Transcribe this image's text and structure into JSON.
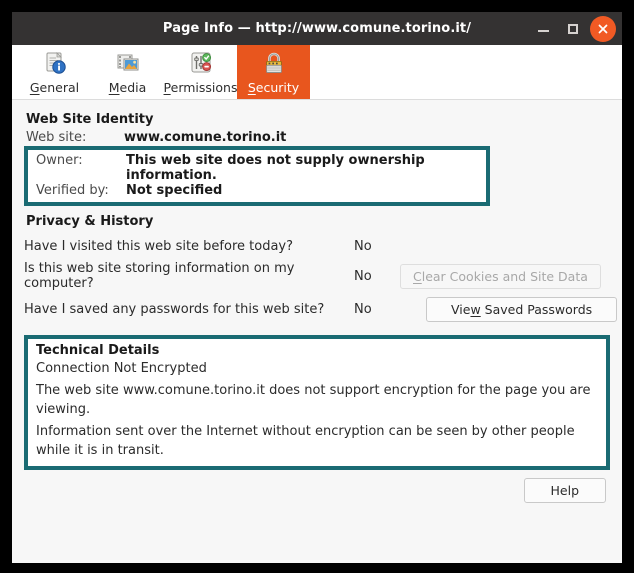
{
  "window": {
    "title": "Page Info — http://www.comune.torino.it/",
    "controls": {
      "minimize": "minimize-button",
      "maximize": "maximize-button",
      "close": "close-button"
    }
  },
  "tabs": [
    {
      "id": "general",
      "label": "General",
      "accesskey": "G",
      "icon": "document-info-icon",
      "selected": false
    },
    {
      "id": "media",
      "label": "Media",
      "accesskey": "M",
      "icon": "media-image-icon",
      "selected": false
    },
    {
      "id": "permissions",
      "label": "Permissions",
      "accesskey": "P",
      "icon": "sliders-check-icon",
      "selected": false
    },
    {
      "id": "security",
      "label": "Security",
      "accesskey": "S",
      "icon": "padlock-icon",
      "selected": true
    }
  ],
  "identity": {
    "heading": "Web Site Identity",
    "website_label": "Web site:",
    "website_value": "www.comune.torino.it",
    "owner_label": "Owner:",
    "owner_value": "This web site does not supply ownership information.",
    "verified_label": "Verified by:",
    "verified_value": "Not specified"
  },
  "privacy": {
    "heading": "Privacy & History",
    "rows": [
      {
        "question": "Have I visited this web site before today?",
        "answer": "No",
        "button": null
      },
      {
        "question": "Is this web site storing information on my computer?",
        "answer": "No",
        "button": {
          "label": "Clear Cookies and Site Data",
          "accesskey": "C",
          "disabled": true
        }
      },
      {
        "question": "Have I saved any passwords for this web site?",
        "answer": "No",
        "button": {
          "label": "View Saved Passwords",
          "accesskey": "w",
          "disabled": false
        }
      }
    ]
  },
  "technical": {
    "heading": "Technical Details",
    "status": "Connection Not Encrypted",
    "line1": "The web site www.comune.torino.it does not support encryption for the page you are viewing.",
    "line2": "Information sent over the Internet without encryption can be seen by other people while it is in transit."
  },
  "footer": {
    "help_label": "Help"
  },
  "colors": {
    "titlebar": "#343232",
    "selected_tab": "#e8561e",
    "close_button": "#f15a24",
    "highlight_border": "#1a6b73",
    "content_bg": "#f7f7f7"
  }
}
